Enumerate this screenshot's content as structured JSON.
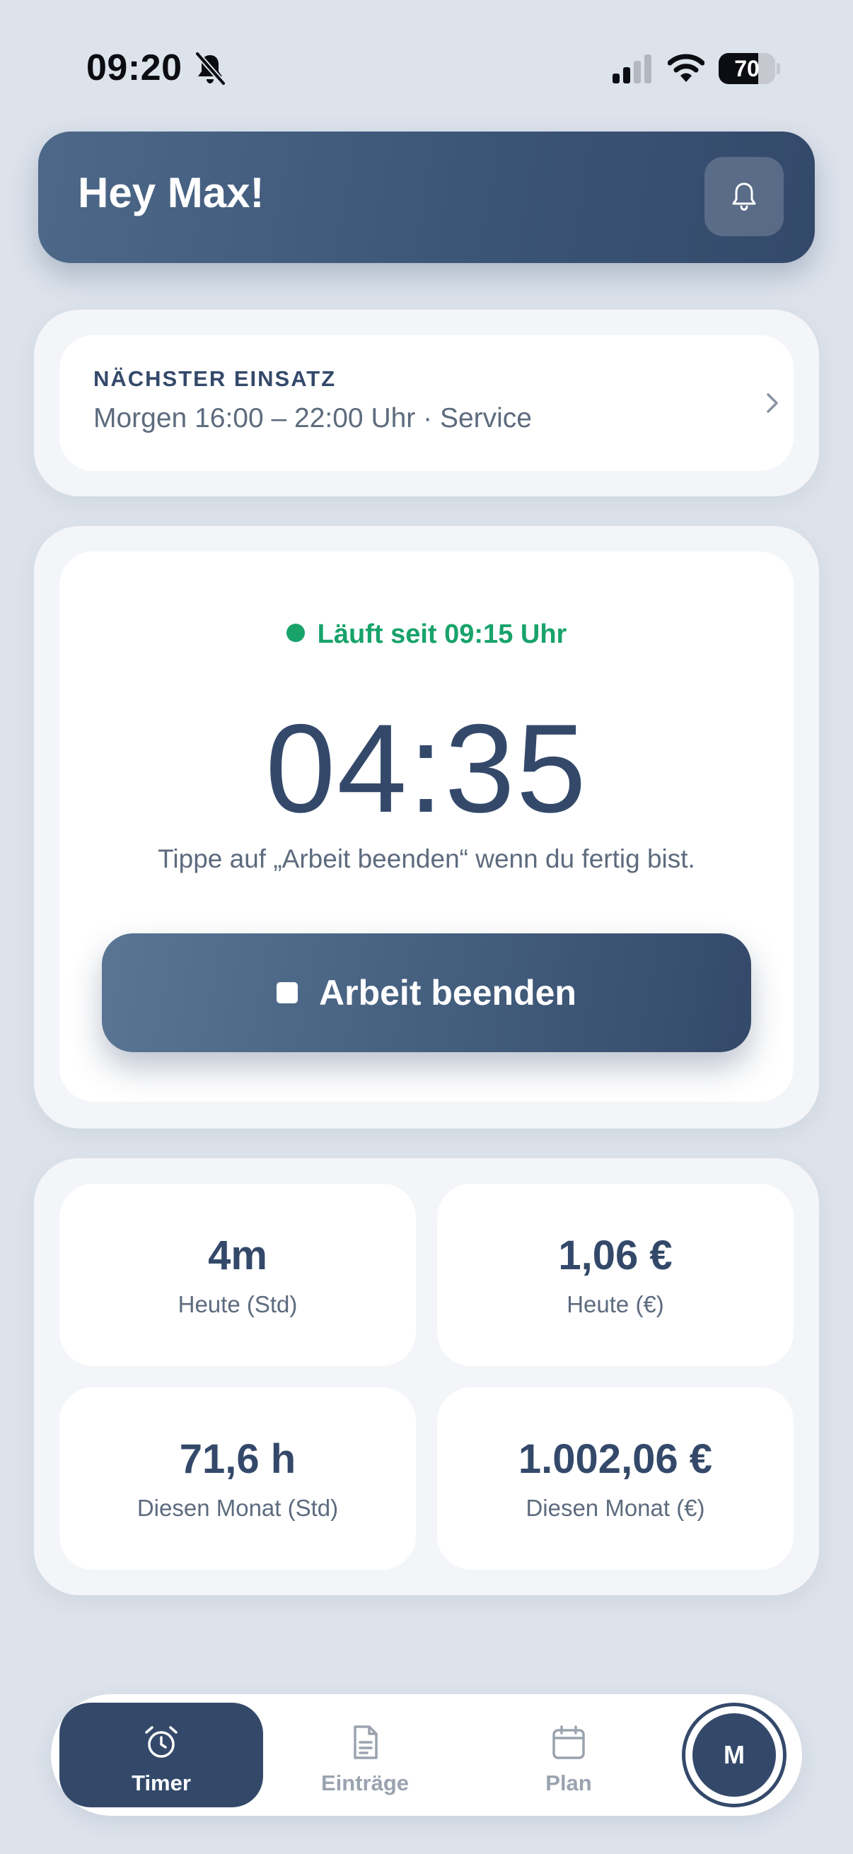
{
  "status_bar": {
    "time": "09:20",
    "battery_percent": "70",
    "battery_level": 0.7,
    "icons": [
      "bell-slash-icon",
      "cellular-signal-icon",
      "wifi-icon",
      "battery-icon"
    ]
  },
  "header": {
    "greeting": "Hey Max!",
    "icon": "bell-icon"
  },
  "next_shift": {
    "label": "NÄCHSTER EINSATZ",
    "detail": "Morgen 16:00 – 22:00 Uhr · Service",
    "icon": "chevron-right-icon"
  },
  "timer": {
    "status": "Läuft seit 09:15 Uhr",
    "elapsed": "04:35",
    "hint": "Tippe auf „Arbeit beenden“ wenn du fertig bist.",
    "stop_label": "Arbeit beenden",
    "stop_icon": "stop-icon"
  },
  "stats": [
    {
      "value": "4m",
      "label": "Heute (Std)"
    },
    {
      "value": "1,06 €",
      "label": "Heute (€)"
    },
    {
      "value": "71,6 h",
      "label": "Diesen Monat (Std)"
    },
    {
      "value": "1.002,06 €",
      "label": "Diesen Monat (€)"
    }
  ],
  "nav": {
    "items": [
      {
        "label": "Timer",
        "icon": "alarm-clock-icon",
        "active": true
      },
      {
        "label": "Einträge",
        "icon": "document-icon",
        "active": false
      },
      {
        "label": "Plan",
        "icon": "calendar-icon",
        "active": false
      }
    ],
    "avatar_initial": "M"
  },
  "colors": {
    "primary": "#34496a",
    "running_green": "#18a36b",
    "background": "#dde3eb",
    "muted_text": "#5d6b7e",
    "inactive_nav": "#9aa3af"
  }
}
